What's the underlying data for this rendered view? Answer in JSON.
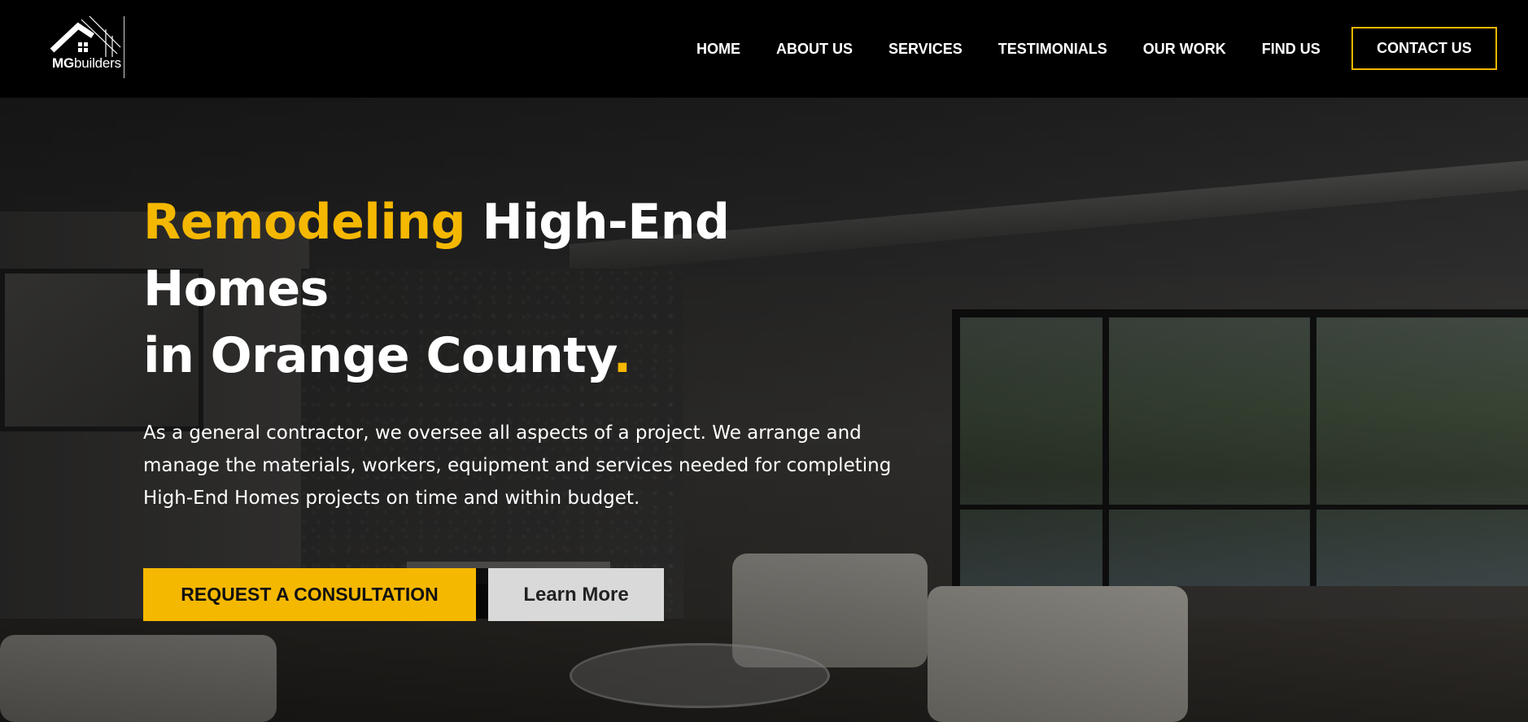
{
  "brand": {
    "logo_text_bold": "MG",
    "logo_text_rest": "builders",
    "icon": "house-roof-icon"
  },
  "nav": {
    "items": [
      {
        "label": "HOME"
      },
      {
        "label": "ABOUT US"
      },
      {
        "label": "SERVICES"
      },
      {
        "label": "TESTIMONIALS"
      },
      {
        "label": "OUR WORK"
      },
      {
        "label": "FIND US"
      }
    ],
    "cta_label": "CONTACT US"
  },
  "hero": {
    "headline_accent": "Remodeling",
    "headline_rest": " High-End Homes",
    "headline_line2": "in Orange County",
    "headline_period": ".",
    "description": "As a general contractor, we oversee all aspects of a project. We arrange and manage the materials, workers, equipment and services needed for completing High-End Homes projects on time and within budget.",
    "primary_button": "REQUEST A CONSULTATION",
    "secondary_button": "Learn More"
  },
  "colors": {
    "accent": "#f5b800",
    "header_bg": "#000000",
    "secondary_button_bg": "#d9d9d9"
  }
}
